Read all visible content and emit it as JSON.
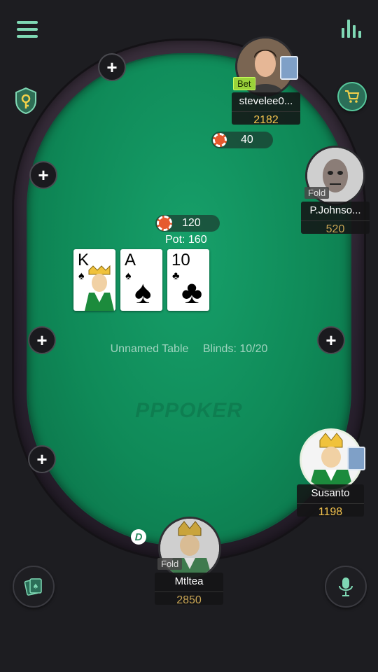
{
  "table": {
    "name": "Unnamed Table",
    "blinds": "Blinds: 10/20",
    "watermark": "PPPOKER",
    "pot_label": "Pot: 160",
    "pot_chips": "120",
    "bet_chips": "40"
  },
  "community_cards": [
    {
      "rank": "K",
      "suit": "♠"
    },
    {
      "rank": "A",
      "suit": "♠"
    },
    {
      "rank": "10",
      "suit": "♣"
    }
  ],
  "players": {
    "top": {
      "name": "stevelee0...",
      "chips": "2182",
      "status": "Bet"
    },
    "right_top": {
      "name": "P.Johnso...",
      "chips": "520",
      "status": "Fold"
    },
    "right_bottom": {
      "name": "Susanto",
      "chips": "1198"
    },
    "bottom": {
      "name": "Mtltea",
      "chips": "2850",
      "status": "Fold"
    }
  },
  "dealer_button": "D",
  "icons": {
    "menu": "menu-icon",
    "stats": "bar-chart-icon",
    "security": "shield-key-icon",
    "shop": "shopping-cart-icon",
    "cards": "card-deck-icon",
    "mic": "microphone-icon"
  },
  "colors": {
    "felt": "#0f8a58",
    "accent": "#7fd8b4",
    "chips_text": "#f2c24e",
    "bet_tag": "#9ad23a"
  }
}
